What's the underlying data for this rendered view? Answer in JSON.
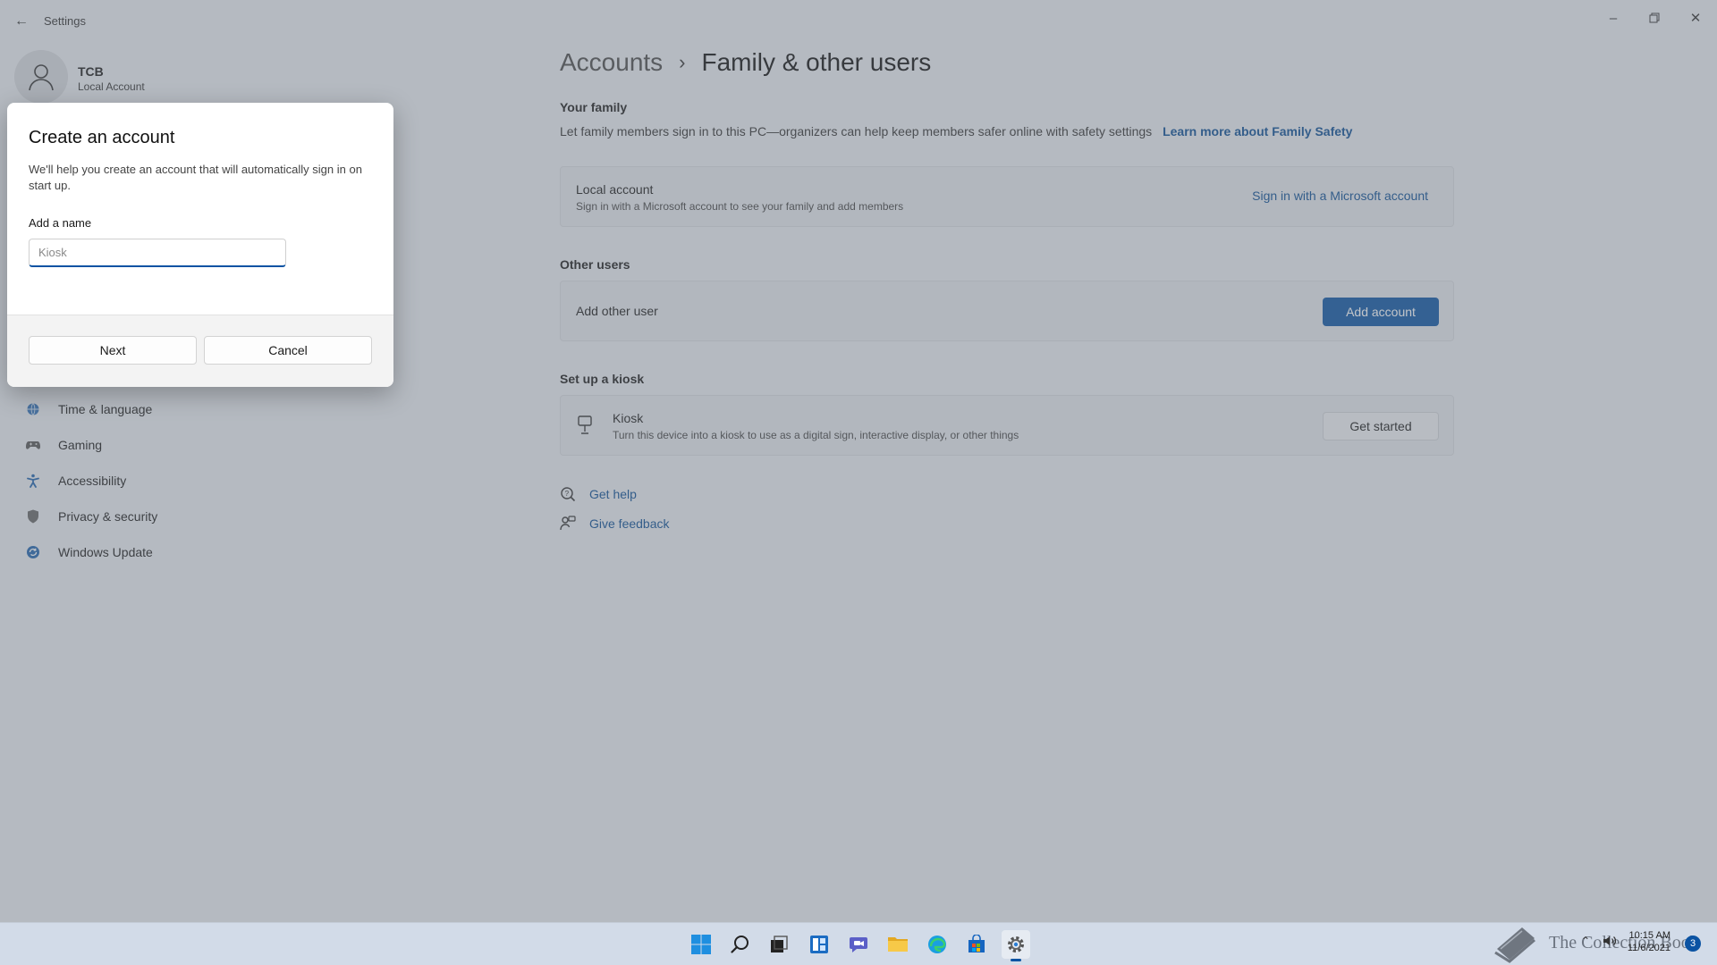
{
  "window": {
    "title": "Settings",
    "controls": [
      "minimize",
      "restore",
      "close"
    ]
  },
  "profile": {
    "name": "TCB",
    "account_type": "Local Account"
  },
  "sidebar": {
    "items": [
      {
        "label": "Time & language",
        "icon": "globe-clock-icon"
      },
      {
        "label": "Gaming",
        "icon": "gamepad-icon"
      },
      {
        "label": "Accessibility",
        "icon": "accessibility-icon"
      },
      {
        "label": "Privacy & security",
        "icon": "shield-icon"
      },
      {
        "label": "Windows Update",
        "icon": "update-icon"
      }
    ]
  },
  "breadcrumb": {
    "parent": "Accounts",
    "separator": ">",
    "current": "Family & other users"
  },
  "family": {
    "section_title": "Your family",
    "description": "Let family members sign in to this PC—organizers can help keep members safer online with safety settings",
    "learn_more": "Learn more about Family Safety",
    "card_title": "Local account",
    "card_subtitle": "Sign in with a Microsoft account to see your family and add members",
    "sign_in_link": "Sign in with a Microsoft account"
  },
  "other_users": {
    "section_title": "Other users",
    "card_title": "Add other user",
    "button": "Add account"
  },
  "kiosk": {
    "section_title": "Set up a kiosk",
    "card_title": "Kiosk",
    "card_subtitle": "Turn this device into a kiosk to use as a digital sign, interactive display, or other things",
    "button": "Get started"
  },
  "help_links": {
    "get_help": "Get help",
    "give_feedback": "Give feedback"
  },
  "dialog": {
    "title": "Create an account",
    "description": "We'll help you create an account that will automatically sign in on start up.",
    "field_label": "Add a name",
    "input_value": "",
    "input_placeholder": "Kiosk",
    "primary_button": "Next",
    "secondary_button": "Cancel"
  },
  "taskbar": {
    "apps": [
      "start",
      "search",
      "task-view",
      "widgets",
      "chat",
      "file-explorer",
      "edge",
      "store",
      "settings"
    ],
    "active_app": "settings",
    "watermark": "The Collection Book",
    "time": "10:15 AM",
    "date": "11/6/2021",
    "notification_count": "3"
  },
  "colors": {
    "accent": "#0b53a3",
    "link": "#0a4c93",
    "window_bg": "#e9ecf1",
    "dialog_bg": "#ffffff",
    "taskbar_bg": "#d2dbe8"
  }
}
